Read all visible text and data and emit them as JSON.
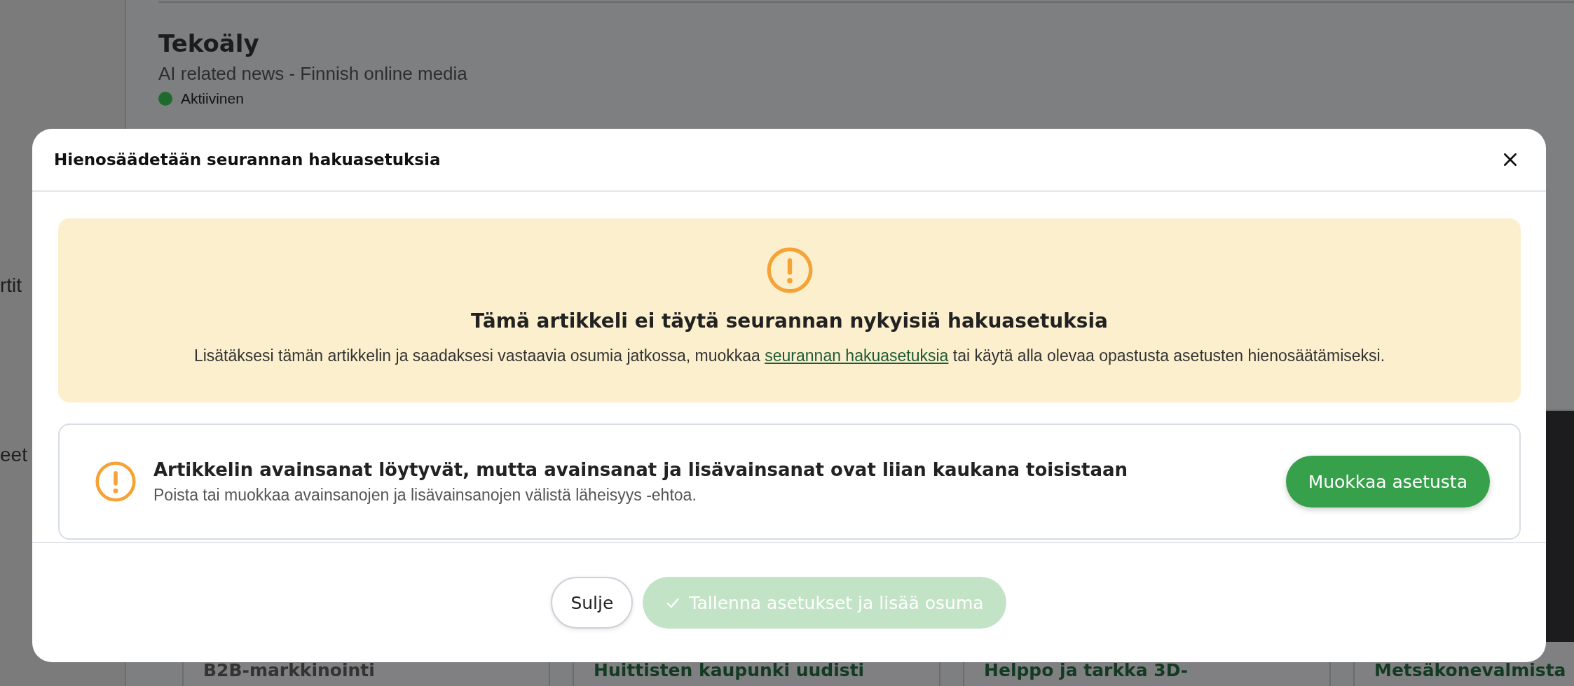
{
  "sidebar": {
    "items": [
      {
        "label": "rtit"
      },
      {
        "label": "eet"
      }
    ]
  },
  "monitor": {
    "title": "Tekoäly",
    "subtitle": "AI related news - Finnish online media",
    "status": {
      "label": "Aktiivinen",
      "color": "#1f6b2e"
    }
  },
  "cards": [
    {
      "title": "B2B-markkinointi"
    },
    {
      "title": "Huittisten kaupunki uudisti"
    },
    {
      "title": "Helppo ja tarkka 3D-"
    },
    {
      "title": "Metsäkonevalmista",
      "photo": true
    }
  ],
  "dialog": {
    "title": "Hienosäädetään seurannan hakuasetuksia",
    "notice": {
      "title": "Tämä artikkeli ei täytä seurannan nykyisiä hakuasetuksia",
      "text_before": "Lisätäksesi tämän artikkelin ja saadaksesi vastaavia osumia jatkossa, muokkaa ",
      "link": "seurannan hakuasetuksia",
      "text_after": " tai käytä alla olevaa opastusta asetusten hienosäätämiseksi."
    },
    "issues": [
      {
        "title": "Artikkelin avainsanat löytyvät, mutta avainsanat ja lisävainsanat ovat liian kaukana toisistaan",
        "text": "Poista tai muokkaa avainsanojen ja lisävainsanojen välistä läheisyys -ehtoa.",
        "button": "Muokkaa asetusta"
      }
    ],
    "buttons": [
      {
        "kind": "secondary",
        "label": "Sulje",
        "disabled": false
      },
      {
        "kind": "primary",
        "label": "Tallenna asetukset ja lisää osuma",
        "disabled": true
      }
    ]
  }
}
